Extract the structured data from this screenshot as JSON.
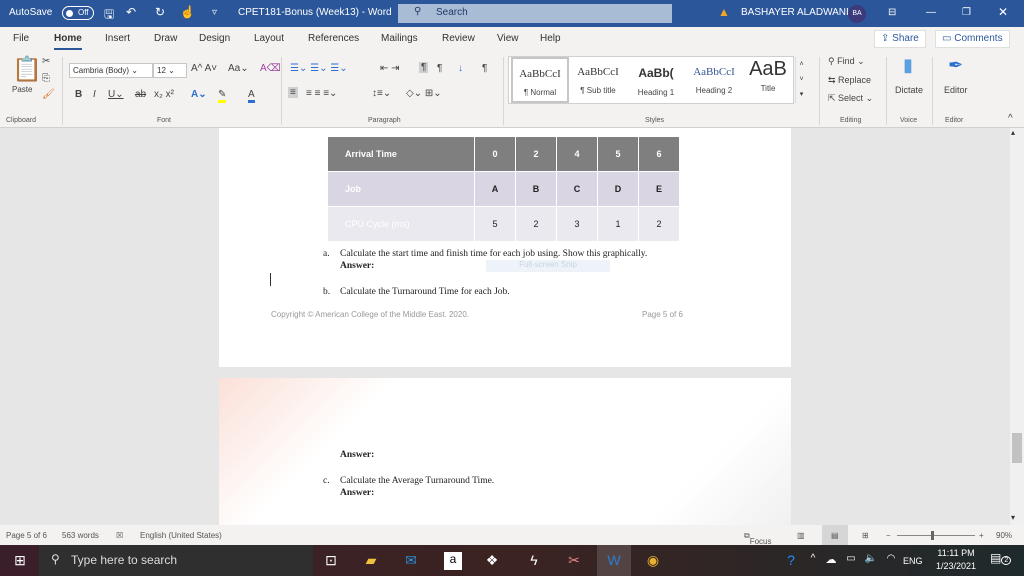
{
  "titlebar": {
    "autosave": "AutoSave",
    "autosave_state": "Off",
    "doc_title": "CPET181-Bonus (Week13)  -  Word",
    "search": "Search",
    "user": "BASHAYER ALADWANI",
    "initials": "BA"
  },
  "tabs": [
    "File",
    "Home",
    "Insert",
    "Draw",
    "Design",
    "Layout",
    "References",
    "Mailings",
    "Review",
    "View",
    "Help"
  ],
  "active_tab": "Home",
  "share": "Share",
  "comments": "Comments",
  "ribbon": {
    "font_name": "Cambria (Body)",
    "font_size": "12",
    "paste": "Paste",
    "groups": [
      "Clipboard",
      "Font",
      "Paragraph",
      "Styles",
      "Editing",
      "Voice",
      "Editor"
    ],
    "styles": [
      {
        "sample": "AaBbCcI",
        "label": "¶ Normal"
      },
      {
        "sample": "AaBbCcI",
        "label": "¶ Sub title"
      },
      {
        "sample": "AaBb(",
        "label": "Heading 1"
      },
      {
        "sample": "AaBbCcI",
        "label": "Heading 2"
      },
      {
        "sample": "AaB",
        "label": "Title"
      }
    ],
    "editing": {
      "find": "Find",
      "replace": "Replace",
      "select": "Select"
    },
    "dictate": "Dictate",
    "editor": "Editor"
  },
  "document": {
    "table": [
      [
        "Arrival Time",
        "0",
        "2",
        "4",
        "5",
        "6"
      ],
      [
        "Job",
        "A",
        "B",
        "C",
        "D",
        "E"
      ],
      [
        "CPU Cycle (ms)",
        "5",
        "2",
        "3",
        "1",
        "2"
      ]
    ],
    "q_a_marker": "a.",
    "q_a": "Calculate the start time and finish time for each job using. Show this graphically.",
    "answer": "Answer:",
    "snip_overlay": "Full-screen Snip",
    "q_b_marker": "b.",
    "q_b": "Calculate the Turnaround Time for each Job.",
    "footer_left": "Copyright © American College of the Middle East. 2020.",
    "footer_right": "Page 5 of 6",
    "q_c_marker": "c.",
    "q_c": "Calculate the Average Turnaround Time."
  },
  "status": {
    "page": "Page 5 of 6",
    "words": "563 words",
    "language": "English (United States)",
    "focus": "Focus",
    "zoom": "90%",
    "zoom_percent": 90
  },
  "taskbar": {
    "search_placeholder": "Type here to search",
    "lang": "ENG",
    "time": "11:11 PM",
    "date": "1/23/2021",
    "notifications": "2"
  },
  "colors": {
    "title_blue": "#2b579a",
    "table_header": "#7f7f7f",
    "table_row2": "#d9d5e3"
  }
}
